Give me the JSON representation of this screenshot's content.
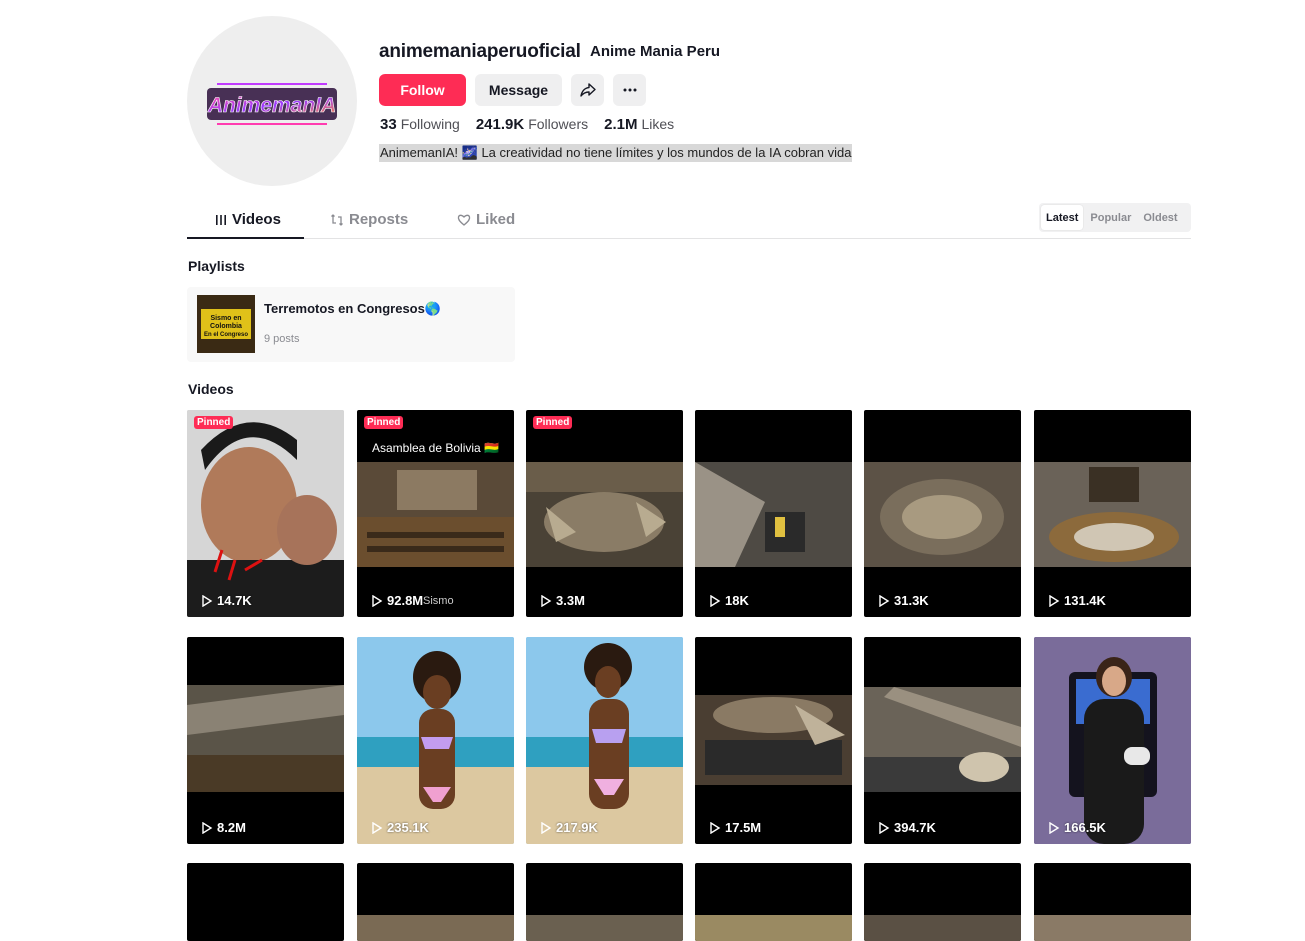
{
  "profile": {
    "username": "animemaniaperuoficial",
    "nickname": "Anime Mania Peru",
    "avatar_logo_text": "AnimemanIA",
    "follow_label": "Follow",
    "message_label": "Message",
    "share_icon": "share-icon",
    "more_icon": "more-icon",
    "stats": {
      "following_count": "33",
      "following_label": "Following",
      "followers_count": "241.9K",
      "followers_label": "Followers",
      "likes_count": "2.1M",
      "likes_label": "Likes"
    },
    "bio": "AnimemanIA! 🌌 La creatividad no tiene límites y los mundos de la IA cobran vida"
  },
  "tabs": [
    {
      "label": "Videos",
      "icon": "grid-icon",
      "active": true
    },
    {
      "label": "Reposts",
      "icon": "repost-icon",
      "active": false
    },
    {
      "label": "Liked",
      "icon": "heart-icon",
      "active": false
    }
  ],
  "sort": {
    "options": [
      "Latest",
      "Popular",
      "Oldest"
    ],
    "active": "Latest"
  },
  "playlists": {
    "title": "Playlists",
    "items": [
      {
        "name": "Terremotos en Congresos🌎",
        "count": "9 posts",
        "thumb_text": "Sismo en Colombia En el Congreso"
      }
    ]
  },
  "videos": {
    "title": "Videos",
    "pinned_label": "Pinned",
    "items": [
      {
        "views": "14.7K",
        "pinned": true
      },
      {
        "views": "92.8M",
        "pinned": true,
        "caption": "Asamblea de Bolivia 🇧🇴",
        "extra": "Sismo"
      },
      {
        "views": "3.3M",
        "pinned": true
      },
      {
        "views": "18K",
        "pinned": false
      },
      {
        "views": "31.3K",
        "pinned": false
      },
      {
        "views": "131.4K",
        "pinned": false
      },
      {
        "views": "8.2M",
        "pinned": false
      },
      {
        "views": "235.1K",
        "pinned": false
      },
      {
        "views": "217.9K",
        "pinned": false
      },
      {
        "views": "17.5M",
        "pinned": false
      },
      {
        "views": "394.7K",
        "pinned": false
      },
      {
        "views": "166.5K",
        "pinned": false
      }
    ]
  },
  "colors": {
    "accent": "#fe2c55",
    "text": "#161823",
    "muted": "#8a8b91"
  }
}
